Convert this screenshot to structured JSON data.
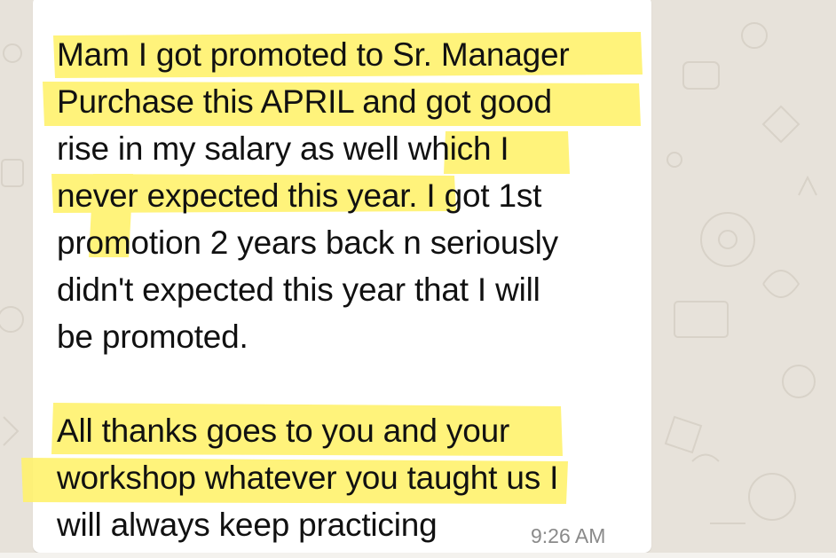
{
  "message": {
    "paragraph1": [
      "Mam I got promoted to Sr. Manager",
      "Purchase this APRIL and got good",
      "rise in my salary as well which I",
      "never expected this year. I got 1st",
      "promotion 2 years back n seriously",
      "didn't expected this year that I will",
      "be promoted."
    ],
    "paragraph2": [
      "All thanks goes to you and your",
      "workshop whatever you taught us I",
      "will always keep practicing"
    ],
    "time": "9:26 AM"
  },
  "colors": {
    "highlight": "#fff270",
    "bubble": "#ffffff",
    "wallpaper": "#e7e2da",
    "text": "#111111",
    "timestamp": "#8a8a8a"
  },
  "icons": [
    "wallpaper-doodle-icons"
  ]
}
